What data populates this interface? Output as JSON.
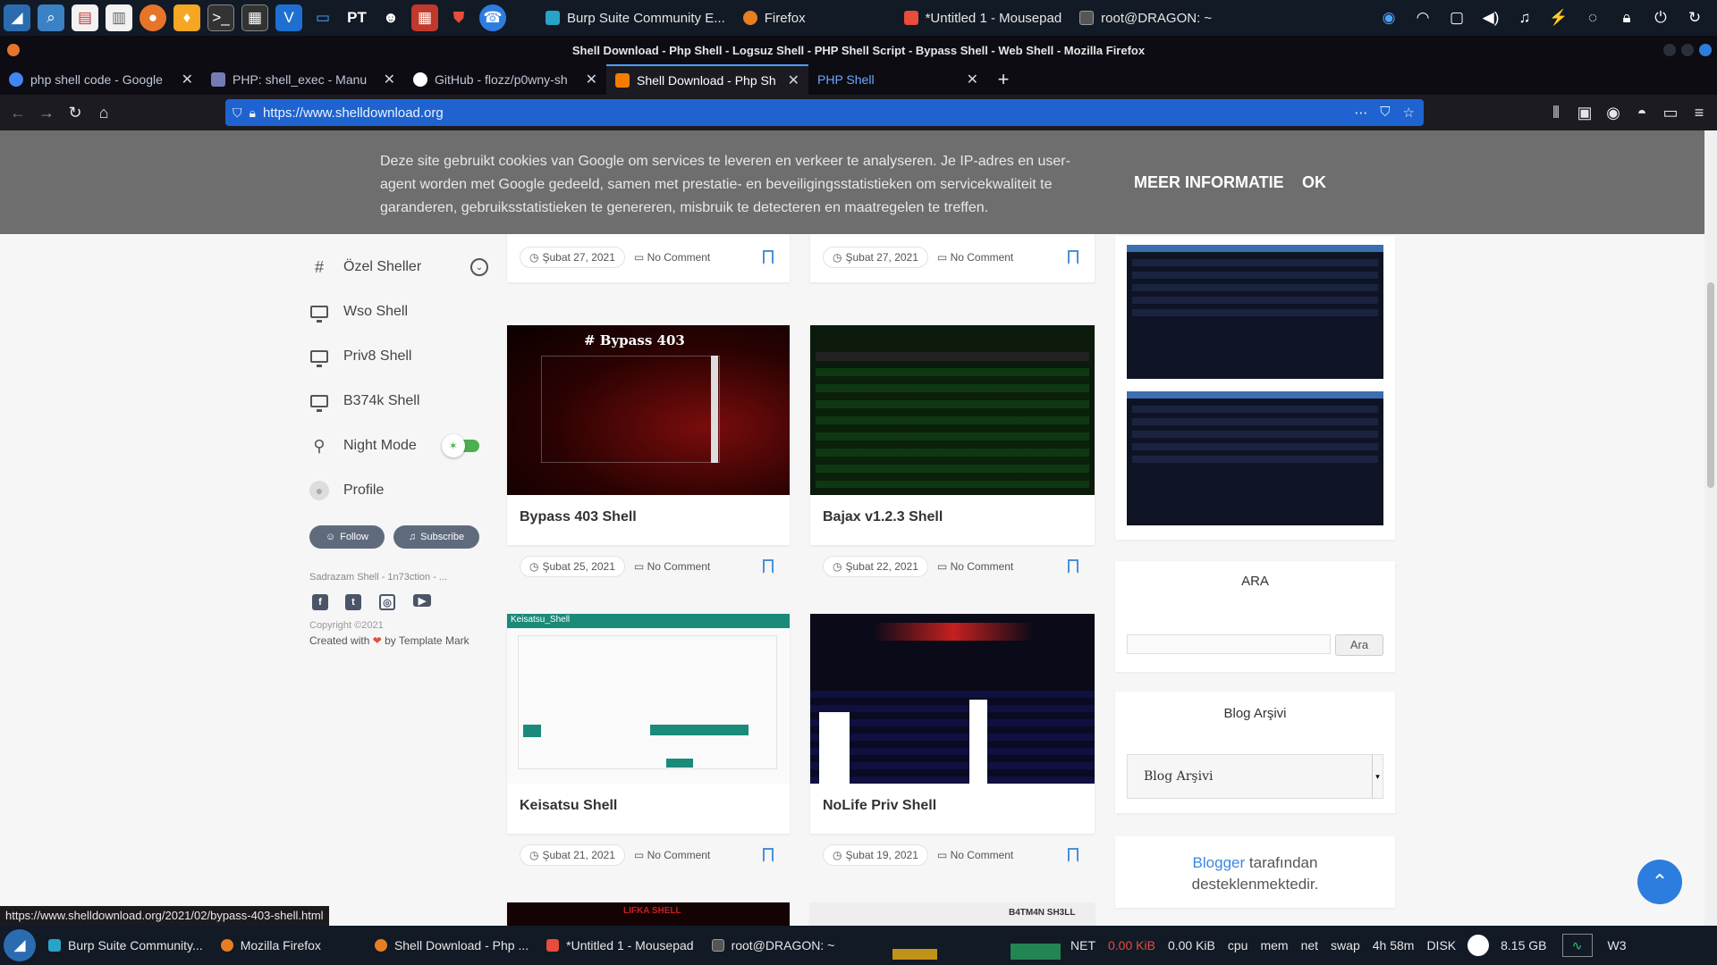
{
  "top_panel": {
    "pt_label": "PT",
    "tasks": [
      {
        "label": "Burp Suite Community E...",
        "color": "#2aa3c8"
      },
      {
        "label": "Firefox",
        "color": "#e67e22"
      },
      {
        "label": "*Untitled 1 - Mousepad",
        "color": "#e74c3c"
      },
      {
        "label": "root@DRAGON: ~",
        "color": "#555555"
      }
    ]
  },
  "browser": {
    "window_title": "Shell Download - Php Shell - Logsuz Shell - PHP Shell Script - Bypass Shell - Web Shell - Mozilla Firefox",
    "tabs": [
      {
        "label": "php shell code - Google",
        "color": "#4285f4"
      },
      {
        "label": "PHP: shell_exec - Manu",
        "color": "#777bb3"
      },
      {
        "label": "GitHub - flozz/p0wny-sh",
        "color": "#ffffff"
      },
      {
        "label": "Shell Download - Php Sh",
        "color": "#f57c00"
      },
      {
        "label": "PHP Shell",
        "color": "#1c1b22"
      }
    ],
    "url": "https://www.shelldownload.org",
    "status_url": "https://www.shelldownload.org/2021/02/bypass-403-shell.html"
  },
  "cookie_banner": {
    "message": "Deze site gebruikt cookies van Google om services te leveren en verkeer te analyseren. Je IP-adres en user-agent worden met Google gedeeld, samen met prestatie- en beveiligingsstatistieken om servicekwaliteit te garanderen, gebruiksstatistieken te genereren, misbruik te detecteren en maatregelen te treffen.",
    "more_label": "MEER INFORMATIE",
    "ok_label": "OK"
  },
  "sidebar": {
    "items": [
      {
        "label": "Özel Sheller",
        "icon": "hash-icon"
      },
      {
        "label": "Wso Shell",
        "icon": "monitor-icon"
      },
      {
        "label": "Priv8 Shell",
        "icon": "monitor-icon"
      },
      {
        "label": "B374k Shell",
        "icon": "monitor-icon"
      },
      {
        "label": "Night Mode",
        "icon": "bulb-icon"
      },
      {
        "label": "Profile",
        "icon": "user-icon"
      }
    ],
    "follow_label": "Follow",
    "subscribe_label": "Subscribe",
    "site_name": "Sadrazam Shell - 1n73ction - ...",
    "copyright": "Copyright ©2021",
    "created_with": "Created with",
    "by_template": "by Template Mark"
  },
  "posts": [
    {
      "title": "",
      "date": "Şubat 27, 2021",
      "comments": "No Comment"
    },
    {
      "title": "",
      "date": "Şubat 27, 2021",
      "comments": "No Comment"
    },
    {
      "title": "Bypass 403 Shell",
      "date": "Şubat 25, 2021",
      "comments": "No Comment",
      "thumb_text": "# Bypass 403"
    },
    {
      "title": "Bajax v1.2.3 Shell",
      "date": "Şubat 22, 2021",
      "comments": "No Comment"
    },
    {
      "title": "Keisatsu Shell",
      "date": "Şubat 21, 2021",
      "comments": "No Comment",
      "thumb_text": "Keisatsu_Shell"
    },
    {
      "title": "NoLife Priv Shell",
      "date": "Şubat 19, 2021",
      "comments": "No Comment"
    }
  ],
  "partial_thumbs": [
    "LIFKA SHELL",
    "B4TM4N SH3LL"
  ],
  "widgets": {
    "search_title": "ARA",
    "search_button": "Ara",
    "archive_title": "Blog Arşivi",
    "archive_selected": "Blog Arşivi",
    "blogger_link": "Blogger",
    "blogger_rest": "tarafından desteklenmektedir."
  },
  "bottom_panel": {
    "tasks": [
      {
        "label": "Burp Suite Community...",
        "color": "#2aa3c8"
      },
      {
        "label": "Mozilla Firefox",
        "color": "#e67e22"
      },
      {
        "label": "Shell Download - Php ...",
        "color": "#e67e22"
      },
      {
        "label": "*Untitled 1 - Mousepad",
        "color": "#e74c3c"
      },
      {
        "label": "root@DRAGON: ~",
        "color": "#555555"
      }
    ],
    "net_label": "NET",
    "net_down": "0.00 KiB",
    "net_up": "0.00 KiB",
    "cpu": "cpu",
    "mem": "mem",
    "net": "net",
    "swap": "swap",
    "uptime": "4h 58m",
    "disk": "DISK",
    "disk_free": "8.15 GB",
    "workspace": "W3"
  }
}
